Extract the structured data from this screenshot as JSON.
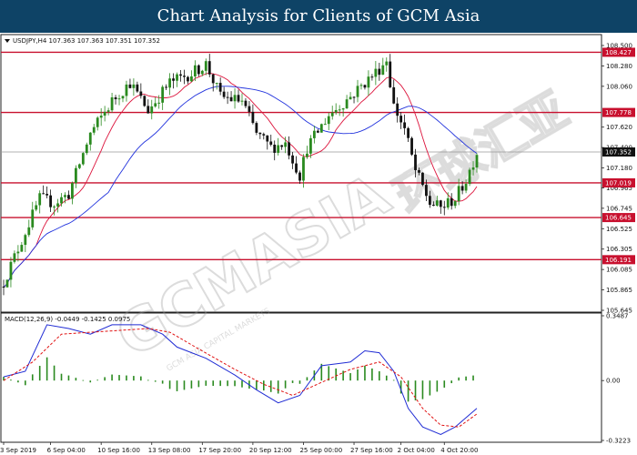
{
  "header": {
    "title": "Chart Analysis for Clients of GCM Asia"
  },
  "watermark": {
    "brand": "GCMASIA",
    "chinese": "环球汇亚",
    "tagline": "GCM ASIA CAPITAL MARKETS"
  },
  "colors": {
    "up_candle": "#2a8a1f",
    "down_candle": "#111111",
    "ma_fast": "#dc143c",
    "ma_slow": "#2233dd",
    "level_line": "#c8102e",
    "price_tag": "#111111",
    "macd_hist": "#2a8a1f",
    "macd_line": "#1f2bd4",
    "signal_line": "#e01010"
  },
  "chart_data": [
    {
      "type": "candlestick",
      "symbol_info": "USDJPY,H4  107.363 107.363 107.351 107.352",
      "ylim": [
        105.645,
        108.5
      ],
      "y_ticks": [
        "108.500",
        "108.280",
        "108.060",
        "107.620",
        "107.400",
        "107.180",
        "106.965",
        "106.745",
        "106.525",
        "106.305",
        "106.085",
        "105.865",
        "105.645"
      ],
      "horizontal_levels": [
        {
          "value": 108.427,
          "label": "108.427"
        },
        {
          "value": 107.778,
          "label": "107.778"
        },
        {
          "value": 107.019,
          "label": "107.019"
        },
        {
          "value": 106.645,
          "label": "106.645"
        },
        {
          "value": 106.191,
          "label": "106.191"
        }
      ],
      "current_price": {
        "value": 107.352,
        "label": "107.352"
      },
      "x_ticks": [
        {
          "index": 0,
          "label": "3 Sep 2019"
        },
        {
          "index": 13,
          "label": "6 Sep 04:00"
        },
        {
          "index": 27,
          "label": "10 Sep 16:00"
        },
        {
          "index": 41,
          "label": "13 Sep 08:00"
        },
        {
          "index": 55,
          "label": "17 Sep 20:00"
        },
        {
          "index": 69,
          "label": "20 Sep 12:00"
        },
        {
          "index": 83,
          "label": "25 Sep 00:00"
        },
        {
          "index": 97,
          "label": "27 Sep 16:00"
        },
        {
          "index": 110,
          "label": "2 Oct 04:00"
        },
        {
          "index": 122,
          "label": "4 Oct 20:00"
        }
      ],
      "close_path": [
        [
          0,
          105.95
        ],
        [
          5,
          106.4
        ],
        [
          10,
          106.85
        ],
        [
          14,
          106.8
        ],
        [
          18,
          106.9
        ],
        [
          24,
          107.55
        ],
        [
          30,
          107.9
        ],
        [
          35,
          108.1
        ],
        [
          40,
          107.8
        ],
        [
          46,
          108.1
        ],
        [
          52,
          108.2
        ],
        [
          56,
          108.3
        ],
        [
          60,
          107.95
        ],
        [
          66,
          107.9
        ],
        [
          70,
          107.55
        ],
        [
          74,
          107.4
        ],
        [
          78,
          107.45
        ],
        [
          82,
          107.1
        ],
        [
          84,
          107.4
        ],
        [
          90,
          107.75
        ],
        [
          96,
          107.95
        ],
        [
          104,
          108.25
        ],
        [
          106,
          108.35
        ],
        [
          108,
          107.85
        ],
        [
          111,
          107.6
        ],
        [
          114,
          107.15
        ],
        [
          118,
          106.8
        ],
        [
          121,
          106.75
        ],
        [
          125,
          106.85
        ],
        [
          128,
          107.05
        ],
        [
          131,
          107.35
        ]
      ],
      "candle_count": 132,
      "overlays": [
        {
          "name": "MA fast",
          "color_key": "ma_fast"
        },
        {
          "name": "MA slow",
          "color_key": "ma_slow"
        }
      ]
    },
    {
      "type": "macd",
      "label": "MACD(12,26,9) -0.0449 -0.1425 0.0975",
      "ylim": [
        -0.3223,
        0.3487
      ],
      "y_ticks": [
        "0.3487",
        "0.00",
        "-0.3223"
      ],
      "line_path": [
        [
          0,
          0.02
        ],
        [
          6,
          0.05
        ],
        [
          12,
          0.3
        ],
        [
          18,
          0.28
        ],
        [
          24,
          0.25
        ],
        [
          30,
          0.3
        ],
        [
          38,
          0.3
        ],
        [
          44,
          0.25
        ],
        [
          48,
          0.18
        ],
        [
          56,
          0.12
        ],
        [
          64,
          0.03
        ],
        [
          70,
          -0.05
        ],
        [
          76,
          -0.12
        ],
        [
          82,
          -0.08
        ],
        [
          88,
          0.08
        ],
        [
          96,
          0.1
        ],
        [
          100,
          0.16
        ],
        [
          104,
          0.15
        ],
        [
          108,
          0.05
        ],
        [
          112,
          -0.15
        ],
        [
          116,
          -0.25
        ],
        [
          121,
          -0.29
        ],
        [
          125,
          -0.25
        ],
        [
          128,
          -0.2
        ],
        [
          131,
          -0.15
        ]
      ],
      "signal_path": [
        [
          0,
          0.0
        ],
        [
          8,
          0.1
        ],
        [
          16,
          0.25
        ],
        [
          24,
          0.26
        ],
        [
          32,
          0.27
        ],
        [
          40,
          0.28
        ],
        [
          46,
          0.26
        ],
        [
          54,
          0.17
        ],
        [
          64,
          0.06
        ],
        [
          72,
          -0.02
        ],
        [
          80,
          -0.08
        ],
        [
          88,
          -0.01
        ],
        [
          96,
          0.06
        ],
        [
          104,
          0.1
        ],
        [
          110,
          0.02
        ],
        [
          116,
          -0.15
        ],
        [
          121,
          -0.24
        ],
        [
          126,
          -0.25
        ],
        [
          131,
          -0.18
        ]
      ]
    }
  ]
}
